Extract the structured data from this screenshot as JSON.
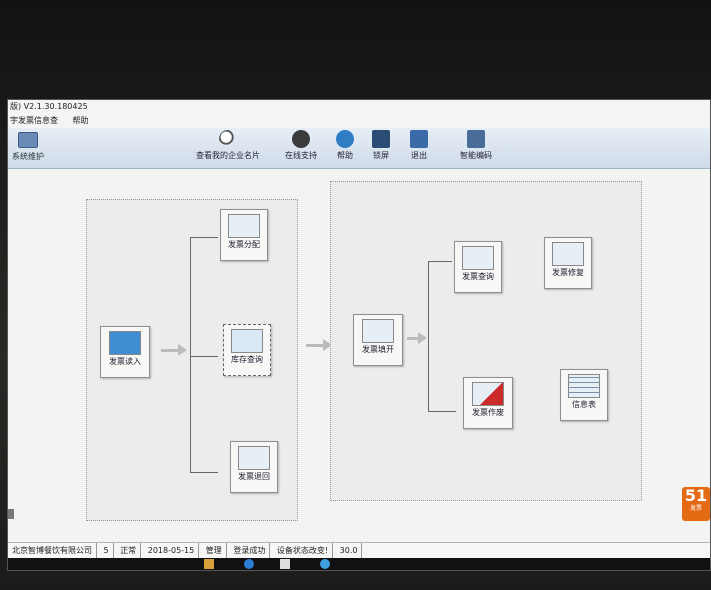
{
  "window": {
    "title": "版) V2.1.30.180425"
  },
  "menu": [
    "宇发票信息查",
    "帮助"
  ],
  "toolbar": {
    "system_label": "系统维护",
    "items": [
      {
        "label": "查看我的企业名片",
        "icon": "magnifier-icon"
      },
      {
        "label": "在线支持",
        "icon": "support-person-icon"
      },
      {
        "label": "帮助",
        "icon": "help-icon"
      },
      {
        "label": "锁屏",
        "icon": "lock-screen-icon"
      },
      {
        "label": "退出",
        "icon": "exit-arrow-icon"
      },
      {
        "label": "智能编码",
        "icon": "smart-code-icon"
      }
    ]
  },
  "flow": {
    "left_panel": {
      "entry": {
        "label": "发票读入"
      },
      "branches": [
        {
          "label": "发票分配"
        },
        {
          "label": "库存查询"
        },
        {
          "label": "发票退回"
        }
      ]
    },
    "right_panel": {
      "entry": {
        "label": "发票填开"
      },
      "branches": [
        {
          "label": "发票查询"
        },
        {
          "label": "发票作废"
        }
      ],
      "extras": [
        {
          "label": "发票修复"
        },
        {
          "label": "信息表"
        }
      ]
    }
  },
  "status": {
    "company": "北京智博餐饮有限公司",
    "num": "5",
    "state": "正常",
    "date": "2018-05-15",
    "role": "管理",
    "login": "登录成功",
    "device": "设备状态改变!",
    "version": "30.0"
  },
  "badge": {
    "number": "51",
    "text": "发票"
  },
  "colors": {
    "toolbar_top": "#e7eef6",
    "toolbar_bottom": "#cfdbe9",
    "badge": "#e46a14"
  }
}
